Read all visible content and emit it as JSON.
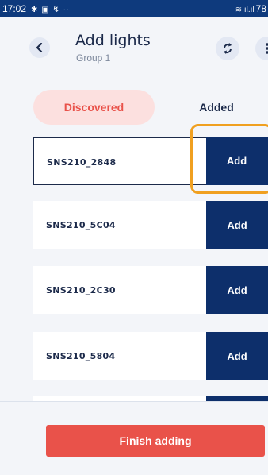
{
  "status_bar": {
    "time": "17:02",
    "left_icons": "✱ ▣ ↯ ··",
    "right_icons": "≋.ıl.ıl",
    "battery": "78"
  },
  "header": {
    "title": "Add lights",
    "subtitle": "Group 1",
    "back_icon": "chevron-left-icon",
    "sync_icon": "sync-icon",
    "more_icon": "more-vertical-icon"
  },
  "tabs": [
    {
      "label": "Discovered",
      "selected": true
    },
    {
      "label": "Added",
      "selected": false
    }
  ],
  "lights": [
    {
      "name": "SNS210_2848",
      "action": "Add"
    },
    {
      "name": "SNS210_5C04",
      "action": "Add"
    },
    {
      "name": "SNS210_2C30",
      "action": "Add"
    },
    {
      "name": "SNS210_5804",
      "action": "Add"
    }
  ],
  "footer": {
    "finish_label": "Finish adding"
  },
  "colors": {
    "navy": "#0d2f6b",
    "accent_red": "#e9524a",
    "tab_selected_bg": "#fce0df",
    "highlight": "#f0a020",
    "background": "#f3f5f9"
  }
}
